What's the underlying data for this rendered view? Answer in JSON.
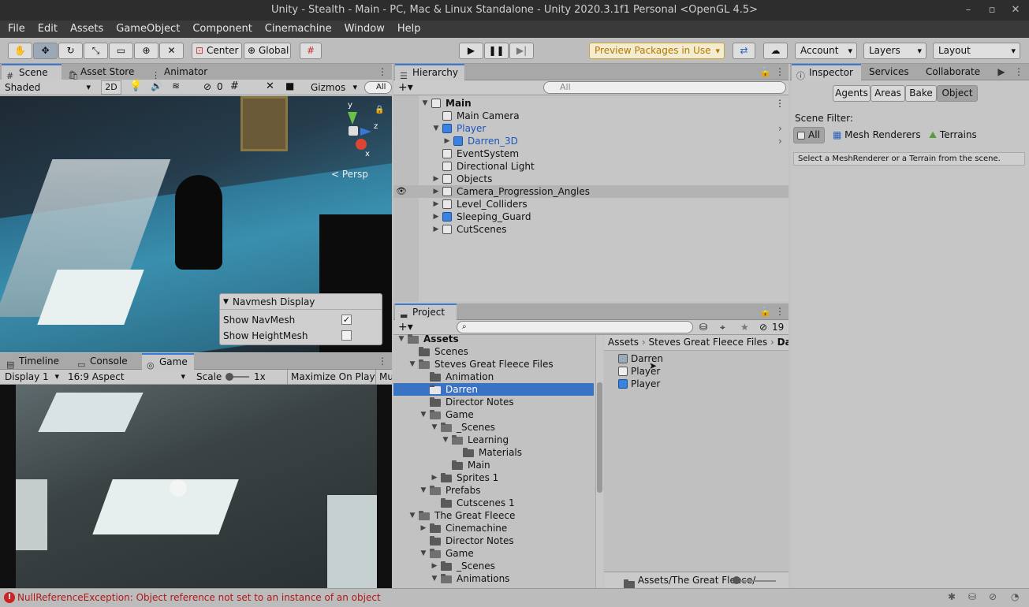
{
  "window": {
    "title": "Unity - Stealth - Main - PC, Mac & Linux Standalone - Unity 2020.3.1f1 Personal <OpenGL 4.5>",
    "minimize": "–",
    "maximize": "▫",
    "close": "✕"
  },
  "menu": [
    "File",
    "Edit",
    "Assets",
    "GameObject",
    "Component",
    "Cinemachine",
    "Window",
    "Help"
  ],
  "toolbar": {
    "pivot": "Center",
    "space": "Global",
    "preview_packages": "Preview Packages in Use",
    "account": "Account",
    "layers": "Layers",
    "layout": "Layout"
  },
  "scene_panel": {
    "tabs": [
      "Scene",
      "Asset Store",
      "Animator"
    ],
    "shading": "Shaded",
    "mode_2d": "2D",
    "hidden_count": "0",
    "gizmos": "Gizmos",
    "search_placeholder": "All",
    "persp": "< Persp",
    "navmesh": {
      "title": "Navmesh Display",
      "show_navmesh": "Show NavMesh",
      "show_heightmesh": "Show HeightMesh",
      "show_navmesh_checked": true,
      "show_heightmesh_checked": false
    }
  },
  "game_panel": {
    "tabs": [
      "Timeline",
      "Console",
      "Game"
    ],
    "display": "Display 1",
    "aspect": "16:9 Aspect",
    "scale_label": "Scale",
    "scale_value": "1x",
    "maximize": "Maximize On Play",
    "mute": "Mu"
  },
  "hierarchy": {
    "tab": "Hierarchy",
    "search_placeholder": "All",
    "items": [
      {
        "label": "Main",
        "indent": 0,
        "arrow": "down",
        "bold": true,
        "icon": "scene-icon"
      },
      {
        "label": "Main Camera",
        "indent": 1,
        "arrow": "",
        "icon": "cube-icon"
      },
      {
        "label": "Player",
        "indent": 1,
        "arrow": "down",
        "icon": "prefab-icon",
        "blue": true
      },
      {
        "label": "Darren_3D",
        "indent": 2,
        "arrow": "right",
        "icon": "prefab-icon",
        "blue": true
      },
      {
        "label": "EventSystem",
        "indent": 1,
        "arrow": "",
        "icon": "cube-icon"
      },
      {
        "label": "Directional Light",
        "indent": 1,
        "arrow": "",
        "icon": "cube-icon"
      },
      {
        "label": "Objects",
        "indent": 1,
        "arrow": "right",
        "icon": "cube-icon"
      },
      {
        "label": "Camera_Progression_Angles",
        "indent": 1,
        "arrow": "right",
        "icon": "cube-icon",
        "hover": true
      },
      {
        "label": "Level_Colliders",
        "indent": 1,
        "arrow": "right",
        "icon": "cube-icon"
      },
      {
        "label": "Sleeping_Guard",
        "indent": 1,
        "arrow": "right",
        "icon": "prefab-icon"
      },
      {
        "label": "CutScenes",
        "indent": 1,
        "arrow": "right",
        "icon": "cube-icon"
      }
    ]
  },
  "inspector": {
    "tabs": [
      "Inspector",
      "Services",
      "Collaborate"
    ],
    "nav_tabs": [
      "Agents",
      "Areas",
      "Bake",
      "Object"
    ],
    "scene_filter_label": "Scene Filter:",
    "filters": [
      "All",
      "Mesh Renderers",
      "Terrains"
    ],
    "hint": "Select a MeshRenderer or a Terrain from the scene."
  },
  "project": {
    "tab": "Project",
    "hidden_count": "19",
    "tree": [
      {
        "label": "Assets",
        "indent": 0,
        "arrow": "down",
        "bold": true
      },
      {
        "label": "Scenes",
        "indent": 1,
        "arrow": ""
      },
      {
        "label": "Steves Great Fleece Files",
        "indent": 1,
        "arrow": "down"
      },
      {
        "label": "Animation",
        "indent": 2,
        "arrow": ""
      },
      {
        "label": "Darren",
        "indent": 2,
        "arrow": "",
        "selected": true
      },
      {
        "label": "Director Notes",
        "indent": 2,
        "arrow": ""
      },
      {
        "label": "Game",
        "indent": 2,
        "arrow": "down"
      },
      {
        "label": "_Scenes",
        "indent": 3,
        "arrow": "down"
      },
      {
        "label": "Learning",
        "indent": 4,
        "arrow": "down"
      },
      {
        "label": "Materials",
        "indent": 5,
        "arrow": ""
      },
      {
        "label": "Main",
        "indent": 4,
        "arrow": ""
      },
      {
        "label": "Sprites 1",
        "indent": 3,
        "arrow": "right"
      },
      {
        "label": "Prefabs",
        "indent": 2,
        "arrow": "down"
      },
      {
        "label": "Cutscenes 1",
        "indent": 3,
        "arrow": ""
      },
      {
        "label": "The Great Fleece",
        "indent": 1,
        "arrow": "down"
      },
      {
        "label": "Cinemachine",
        "indent": 2,
        "arrow": "right"
      },
      {
        "label": "Director Notes",
        "indent": 2,
        "arrow": ""
      },
      {
        "label": "Game",
        "indent": 2,
        "arrow": "down"
      },
      {
        "label": "_Scenes",
        "indent": 3,
        "arrow": "right"
      },
      {
        "label": "Animations",
        "indent": 3,
        "arrow": "down"
      }
    ],
    "breadcrumb": [
      "Assets",
      "Steves Great Fleece Files",
      "Da"
    ],
    "files": [
      "Darren",
      "Player",
      "Player"
    ],
    "footer_path": "Assets/The Great Fleece/"
  },
  "status": {
    "error": "NullReferenceException: Object reference not set to an instance of an object"
  }
}
